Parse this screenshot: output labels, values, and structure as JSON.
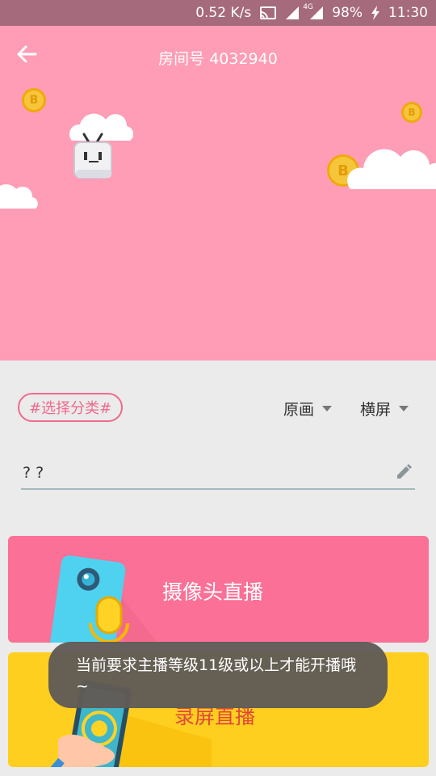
{
  "status_bar": {
    "speed": "0.52 K/s",
    "network": "4G",
    "battery": "98%",
    "time": "11:30"
  },
  "header": {
    "room_label": "房间号 4032940"
  },
  "options": {
    "category_tag": "#选择分类#",
    "quality": "原画",
    "orientation": "横屏"
  },
  "title_field": {
    "value": "? ?"
  },
  "buttons": {
    "camera_live": "摄像头直播",
    "screen_live": "录屏直播"
  },
  "toast": {
    "message": "当前要求主播等级11级或以上才能开播哦~"
  },
  "colors": {
    "hero_pink": "#fe9db5",
    "camera_button": "#fa7096",
    "screen_button": "#ffcf1f",
    "accent": "#f0698d"
  }
}
